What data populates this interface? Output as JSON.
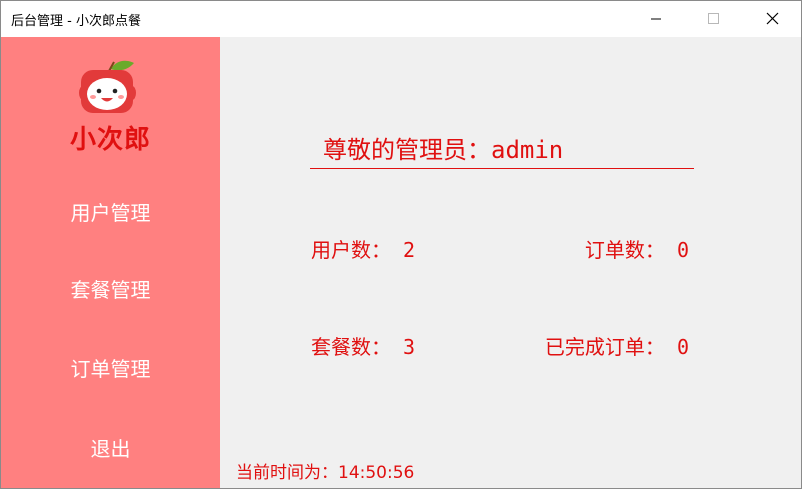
{
  "window": {
    "title": "后台管理 - 小次郎点餐"
  },
  "sidebar": {
    "brand": "小次郎",
    "logo_icon": "apple-mascot-icon",
    "items": [
      {
        "label": "用户管理"
      },
      {
        "label": "套餐管理"
      },
      {
        "label": "订单管理"
      },
      {
        "label": "退出"
      }
    ]
  },
  "main": {
    "greeting": "尊敬的管理员：admin",
    "stats": {
      "users": "用户数： 2",
      "orders": "订单数： 0",
      "packages": "套餐数： 3",
      "completed_orders": "已完成订单： 0"
    },
    "clock": "当前时间为：14:50:56"
  },
  "colors": {
    "sidebar_bg": "#ff8080",
    "accent_red": "#e01010",
    "content_bg": "#f0f0f0"
  }
}
